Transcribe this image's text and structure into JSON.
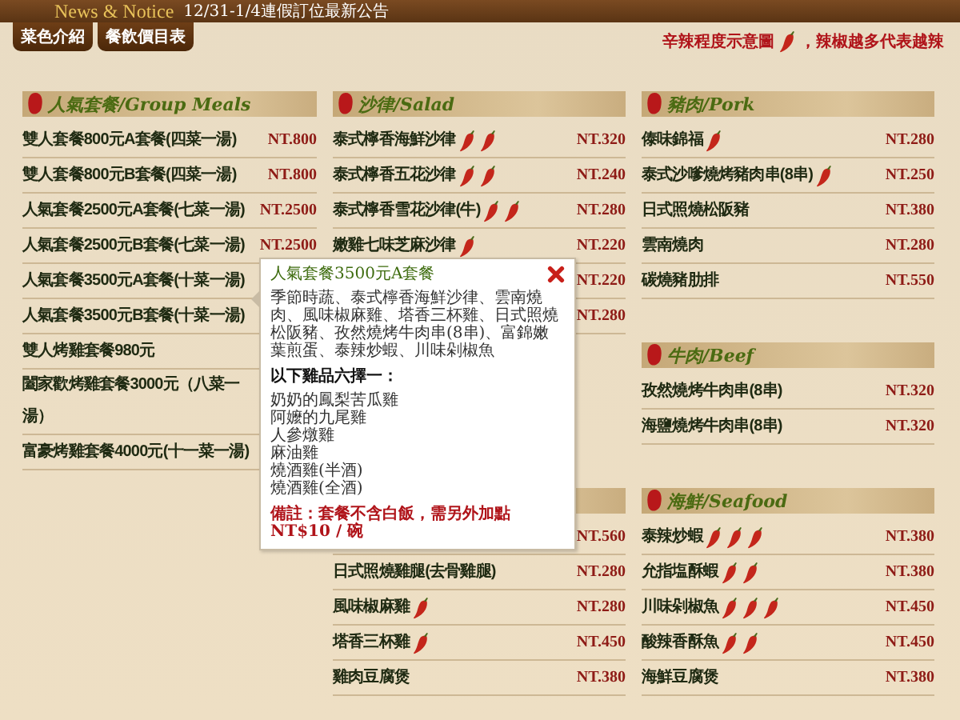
{
  "header": {
    "brand": "News & Notice",
    "notice": "12/31-1/4連假訂位最新公告"
  },
  "tabs": [
    {
      "label": "菜色介紹"
    },
    {
      "label": "餐飲價目表"
    }
  ],
  "legend": {
    "label": "辛辣程度示意圖",
    "note": "，辣椒越多代表越辣"
  },
  "columns": [
    {
      "sections": [
        {
          "title": "人氣套餐/Group Meals",
          "items": [
            {
              "name": "雙人套餐800元A套餐(四菜一湯)",
              "price": "NT.800"
            },
            {
              "name": "雙人套餐800元B套餐(四菜一湯)",
              "price": "NT.800"
            },
            {
              "name": "人氣套餐2500元A套餐(七菜一湯)",
              "price": "NT.2500"
            },
            {
              "name": "人氣套餐2500元B套餐(七菜一湯)",
              "price": "NT.2500"
            },
            {
              "name": "人氣套餐3500元A套餐(十菜一湯)"
            },
            {
              "name": "人氣套餐3500元B套餐(十菜一湯)"
            },
            {
              "name": "雙人烤雞套餐980元"
            },
            {
              "name": "闔家歡烤雞套餐3000元（八菜一湯）"
            },
            {
              "name": "富豪烤雞套餐4000元(十一菜一湯)"
            }
          ]
        }
      ]
    },
    {
      "sections": [
        {
          "title": "沙律/Salad",
          "items": [
            {
              "name": "泰式檸香海鮮沙律",
              "spice": [
                {
                  "kind": "chili"
                },
                {
                  "kind": "chili"
                }
              ],
              "price": "NT.320"
            },
            {
              "name": "泰式檸香五花沙律",
              "spice": [
                {
                  "kind": "chili"
                },
                {
                  "kind": "chili"
                }
              ],
              "price": "NT.240"
            },
            {
              "name": "泰式檸香雪花沙律(牛)",
              "spice": [
                {
                  "kind": "chili"
                },
                {
                  "kind": "chili"
                }
              ],
              "price": "NT.280"
            },
            {
              "name": "嫩雞七味芝麻沙律",
              "spice": [
                {
                  "kind": "chili"
                }
              ],
              "price": "NT.220"
            },
            {
              "price": "NT.220"
            },
            {
              "price": "NT.280"
            }
          ]
        },
        {
          "items": [
            {
              "price": "NT.560"
            },
            {
              "name": "日式照燒雞腿(去骨雞腿)",
              "price": "NT.280"
            },
            {
              "name": "風味椒麻雞",
              "spice": [
                {
                  "kind": "chili"
                }
              ],
              "price": "NT.280"
            },
            {
              "name": "塔香三杯雞",
              "spice": [
                {
                  "kind": "chili"
                }
              ],
              "price": "NT.450"
            },
            {
              "name": "雞肉豆腐煲",
              "price": "NT.380"
            }
          ]
        }
      ]
    },
    {
      "sections": [
        {
          "title": "豬肉/Pork",
          "items": [
            {
              "name": "傣味錦福",
              "spice": [
                {
                  "kind": "chili"
                }
              ],
              "price": "NT.280"
            },
            {
              "name": "泰式沙嗲燒烤豬肉串(8串)",
              "spice": [
                {
                  "kind": "chili"
                }
              ],
              "price": "NT.250"
            },
            {
              "name": "日式照燒松阪豬",
              "price": "NT.380"
            },
            {
              "name": "雲南燒肉",
              "price": "NT.280"
            },
            {
              "name": "碳燒豬肋排",
              "price": "NT.550"
            }
          ]
        },
        {
          "title": "牛肉/Beef",
          "items": [
            {
              "name": "孜然燒烤牛肉串(8串)",
              "price": "NT.320"
            },
            {
              "name": "海鹽燒烤牛肉串(8串)",
              "price": "NT.320"
            }
          ]
        },
        {
          "title": "海鮮/Seafood",
          "items": [
            {
              "name": "泰辣炒蝦",
              "spice": [
                {
                  "kind": "chili"
                },
                {
                  "kind": "chili"
                },
                {
                  "kind": "chili"
                }
              ],
              "price": "NT.380"
            },
            {
              "name": "允指塩酥蝦",
              "spice": [
                {
                  "kind": "chili"
                },
                {
                  "kind": "chili"
                }
              ],
              "price": "NT.380"
            },
            {
              "name": "川味剁椒魚",
              "spice": [
                {
                  "kind": "chili"
                },
                {
                  "kind": "chili"
                },
                {
                  "kind": "chili"
                }
              ],
              "price": "NT.450"
            },
            {
              "name": "酸辣香酥魚",
              "spice": [
                {
                  "kind": "chili"
                },
                {
                  "kind": "chili"
                }
              ],
              "price": "NT.450"
            },
            {
              "name": "海鮮豆腐煲",
              "price": "NT.380"
            }
          ]
        }
      ]
    }
  ],
  "popup": {
    "title": "人氣套餐3500元A套餐",
    "description": "季節時蔬、泰式檸香海鮮沙律、雲南燒肉、風味椒麻雞、塔香三杯雞、日式照燒松阪豬、孜然燒烤牛肉串(8串)、富錦嫩葉煎蛋、泰辣炒蝦、川味剁椒魚",
    "choice_heading": "以下雞品六擇一：",
    "choices": [
      "奶奶的鳳梨苦瓜雞",
      "阿嬤的九尾雞",
      "人參燉雞",
      "麻油雞",
      "燒酒雞(半酒)",
      "燒酒雞(全酒)"
    ],
    "note": "備註：套餐不含白飯，需另外加點NT$10 / 碗"
  }
}
